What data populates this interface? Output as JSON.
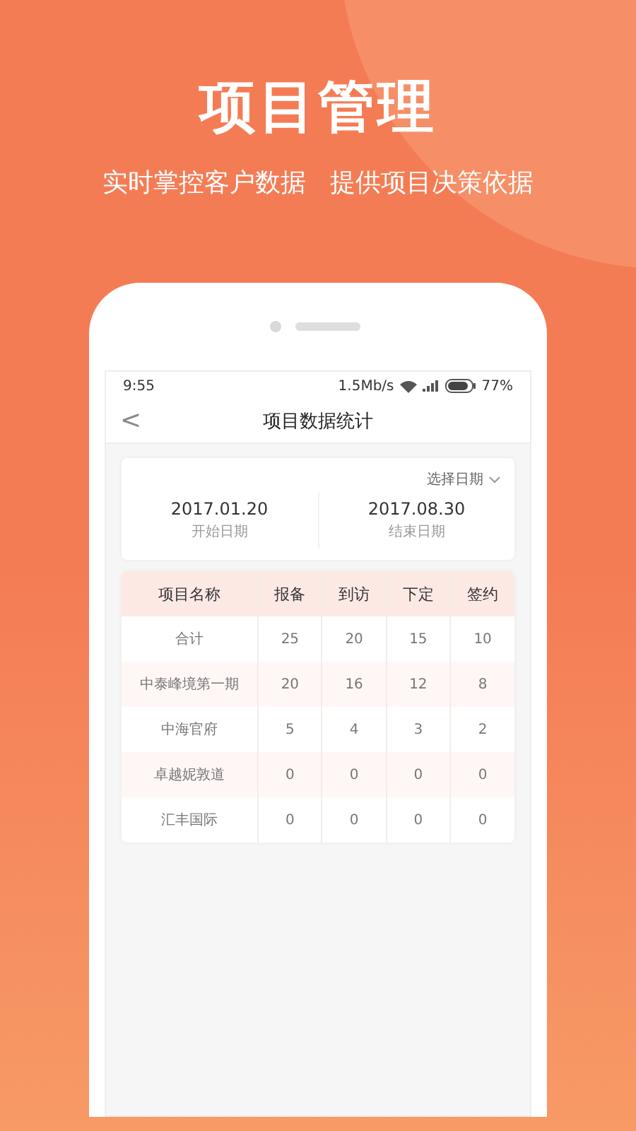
{
  "banner": {
    "title": "项目管理",
    "subtitle": "实时掌控客户数据   提供项目决策依据"
  },
  "status_bar": {
    "time": "9:55",
    "speed": "1.5Mb/s",
    "battery": "77%"
  },
  "nav": {
    "back": "<",
    "title": "项目数据统计"
  },
  "date_card": {
    "picker": "选择日期",
    "start": {
      "date": "2017.01.20",
      "label": "开始日期"
    },
    "end": {
      "date": "2017.08.30",
      "label": "结束日期"
    }
  },
  "table": {
    "columns": [
      "项目名称",
      "报备",
      "到访",
      "下定",
      "签约"
    ],
    "rows": [
      [
        "合计",
        "25",
        "20",
        "15",
        "10"
      ],
      [
        "中泰峰境第一期",
        "20",
        "16",
        "12",
        "8"
      ],
      [
        "中海官府",
        "5",
        "4",
        "3",
        "2"
      ],
      [
        "卓越妮敦道",
        "0",
        "0",
        "0",
        "0"
      ],
      [
        "汇丰国际",
        "0",
        "0",
        "0",
        "0"
      ]
    ]
  }
}
